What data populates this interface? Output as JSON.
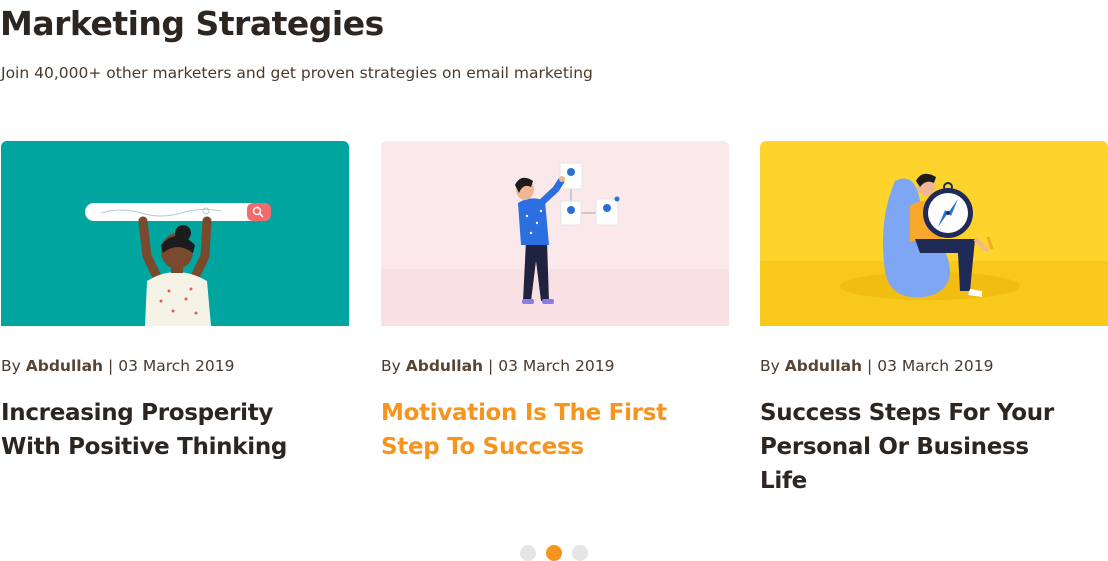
{
  "header": {
    "title": "Marketing Strategies",
    "subtitle": "Join 40,000+ other marketers and get proven strategies on email marketing"
  },
  "cards": [
    {
      "by_label": "By",
      "author": "Abdullah",
      "separator": "|",
      "date": "03 March 2019",
      "title": "Increasing Prosperity With Positive Thinking",
      "image": "person-holding-search-bar-illustration",
      "image_bg": "#00a5a0"
    },
    {
      "by_label": "By",
      "author": "Abdullah",
      "separator": "|",
      "date": "03 March 2019",
      "title": "Motivation Is The First Step To Success",
      "image": "person-arranging-flowchart-illustration",
      "image_bg": "#fbe8ea"
    },
    {
      "by_label": "By",
      "author": "Abdullah",
      "separator": "|",
      "date": "03 March 2019",
      "title": "Success Steps For Your Personal Or Business Life",
      "image": "person-with-compass-on-beanbag-illustration",
      "image_bg": "#fdd32c"
    }
  ],
  "carousel": {
    "page_count": 3,
    "active_index": 1
  },
  "colors": {
    "accent": "#f7941d",
    "heading": "#2d2520",
    "dot_inactive": "#e5e5e5"
  }
}
